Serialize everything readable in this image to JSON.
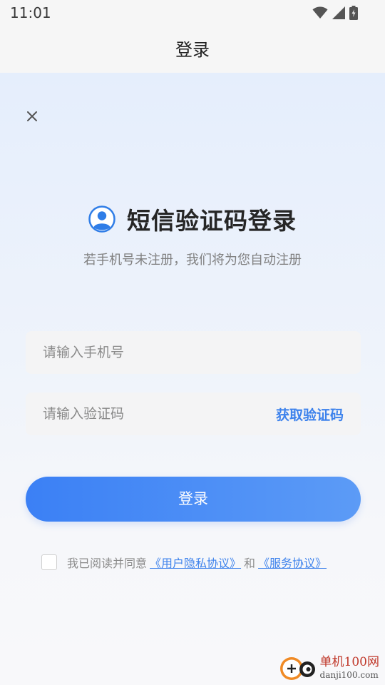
{
  "status_bar": {
    "time": "11:01",
    "icons": [
      "wifi-icon",
      "cell-signal-icon",
      "battery-icon"
    ]
  },
  "header": {
    "title": "登录"
  },
  "main": {
    "close_icon": "close-icon",
    "heading": "短信验证码登录",
    "heading_icon": "user-circle-icon",
    "subtitle": "若手机号未注册，我们将为您自动注册",
    "phone_input": {
      "value": "",
      "placeholder": "请输入手机号"
    },
    "code_input": {
      "value": "",
      "placeholder": "请输入验证码"
    },
    "get_code_label": "获取验证码",
    "login_label": "登录",
    "agreement": {
      "prefix": "我已阅读并同意",
      "privacy_link": "《用户隐私协议》",
      "connector": "和",
      "service_link": "《服务协议》",
      "checked": false
    }
  },
  "watermark": {
    "name": "单机100网",
    "domain": "danji100.com"
  },
  "colors": {
    "accent": "#3d82ec",
    "button_start": "#3b80f5",
    "button_end": "#5c9bf6"
  }
}
